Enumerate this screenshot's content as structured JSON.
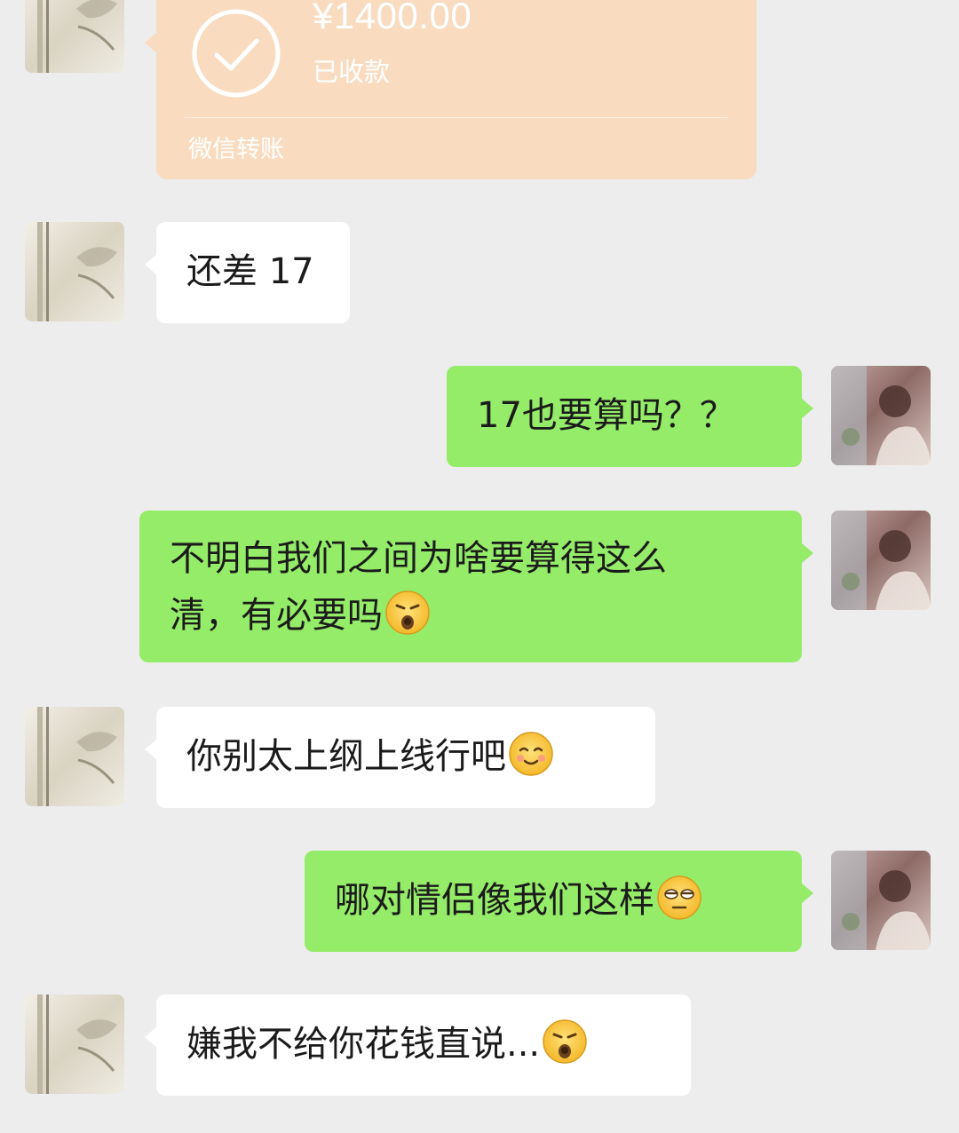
{
  "transfer": {
    "amount": "¥1400.00",
    "status": "已收款",
    "footer": "微信转账",
    "card_color": "#f9dcc0"
  },
  "messages": [
    {
      "side": "in",
      "text": "还差 17"
    },
    {
      "side": "out",
      "text": "17也要算吗？？"
    },
    {
      "side": "out",
      "text": "不明白我们之间为啥要算得这么\n清，有必要吗",
      "emoji": "pouting-face-emoji"
    },
    {
      "side": "in",
      "text": "你别太上纲上线行吧",
      "emoji": "smiling-face-emoji"
    },
    {
      "side": "out",
      "text": "哪对情侣像我们这样",
      "emoji": "unamused-face-emoji"
    },
    {
      "side": "in",
      "text": "嫌我不给你花钱直说...",
      "emoji": "pouting-face-emoji"
    }
  ],
  "colors": {
    "background": "#ededed",
    "incoming_bubble": "#ffffff",
    "outgoing_bubble": "#95ec69"
  }
}
